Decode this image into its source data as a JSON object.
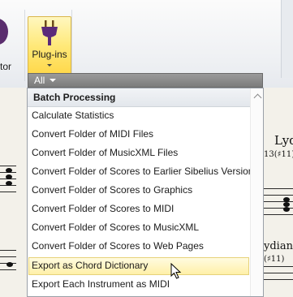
{
  "ribbon": {
    "left_button_label": "tor",
    "plugins_label": "Plug-ins"
  },
  "filter": {
    "label": "All"
  },
  "menu": {
    "header": "Batch Processing",
    "items": [
      "Calculate Statistics",
      "Convert Folder of MIDI Files",
      "Convert Folder of MusicXML Files",
      "Convert Folder of Scores to Earlier Sibelius Version",
      "Convert Folder of Scores to Graphics",
      "Convert Folder of Scores to MIDI",
      "Convert Folder of Scores to MusicXML",
      "Convert Folder of Scores to Web Pages",
      "Export as Chord Dictionary",
      "Export Each Instrument as MIDI"
    ],
    "highlighted_index": 8
  },
  "score": {
    "text_ly": "Lyd",
    "text_13": "13(♯11)",
    "text_ydian": "ydian-",
    "text_sharp": "(♯11)"
  },
  "colors": {
    "plugins_bg": "#ffe97a",
    "highlight_bg": "#fff0a8",
    "filter_bg": "#8a8a8a"
  }
}
